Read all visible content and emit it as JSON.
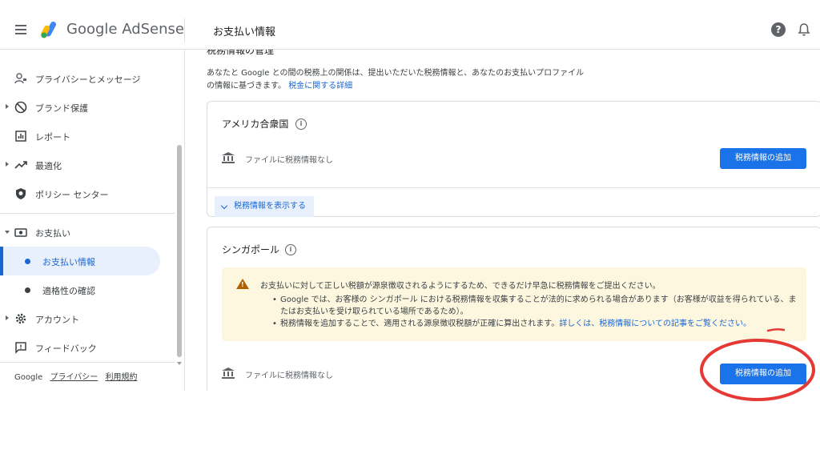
{
  "header": {
    "brand": "Google AdSense",
    "page_title": "お支払い情報",
    "help_icon": "?"
  },
  "sidebar": {
    "items": [
      {
        "label": "プライバシーとメッセージ",
        "icon": "privacy-person-icon"
      },
      {
        "label": "ブランド保護",
        "icon": "block-icon"
      },
      {
        "label": "レポート",
        "icon": "report-chart-icon"
      },
      {
        "label": "最適化",
        "icon": "trending-up-icon"
      },
      {
        "label": "ポリシー センター",
        "icon": "shield-icon"
      },
      {
        "label": "お支払い",
        "icon": "payments-icon"
      },
      {
        "label": "お支払い情報"
      },
      {
        "label": "適格性の確認"
      },
      {
        "label": "アカウント",
        "icon": "gear-icon"
      },
      {
        "label": "フィードバック",
        "icon": "feedback-icon"
      }
    ],
    "footer": {
      "google": "Google",
      "privacy": "プライバシー",
      "terms": "利用規約"
    }
  },
  "main": {
    "section_heading": "税務情報の管理",
    "intro_text": "あなたと Google との間の税務上の関係は、提出いただいた税務情報と、あなたのお支払いプロファイルの情報に基づきます。",
    "intro_link": "税金に関する詳細",
    "us_card": {
      "title": "アメリカ合衆国",
      "no_info": "ファイルに税務情報なし",
      "add_button": "税務情報の追加",
      "show_button": "税務情報を表示する"
    },
    "sg_card": {
      "title": "シンガポール",
      "warning_head": "お支払いに対して正しい税額が源泉徴収されるようにするため、できるだけ早急に税務情報をご提出ください。",
      "bullet1": "Google では、お客様の シンガポール における税務情報を収集することが法的に求められる場合があります（お客様が収益を得られている、またはお支払いを受け取られている場所であるため）。",
      "bullet2_text": "税務情報を追加することで、適用される源泉徴収税額が正確に算出されます。",
      "bullet2_link": "詳しくは、税務情報についての記事をご覧ください。",
      "no_info": "ファイルに税務情報なし",
      "add_button": "税務情報の追加"
    }
  },
  "colors": {
    "primary": "#1a73e8",
    "warning_bg": "#fef7e0",
    "annotation": "#e53935"
  }
}
